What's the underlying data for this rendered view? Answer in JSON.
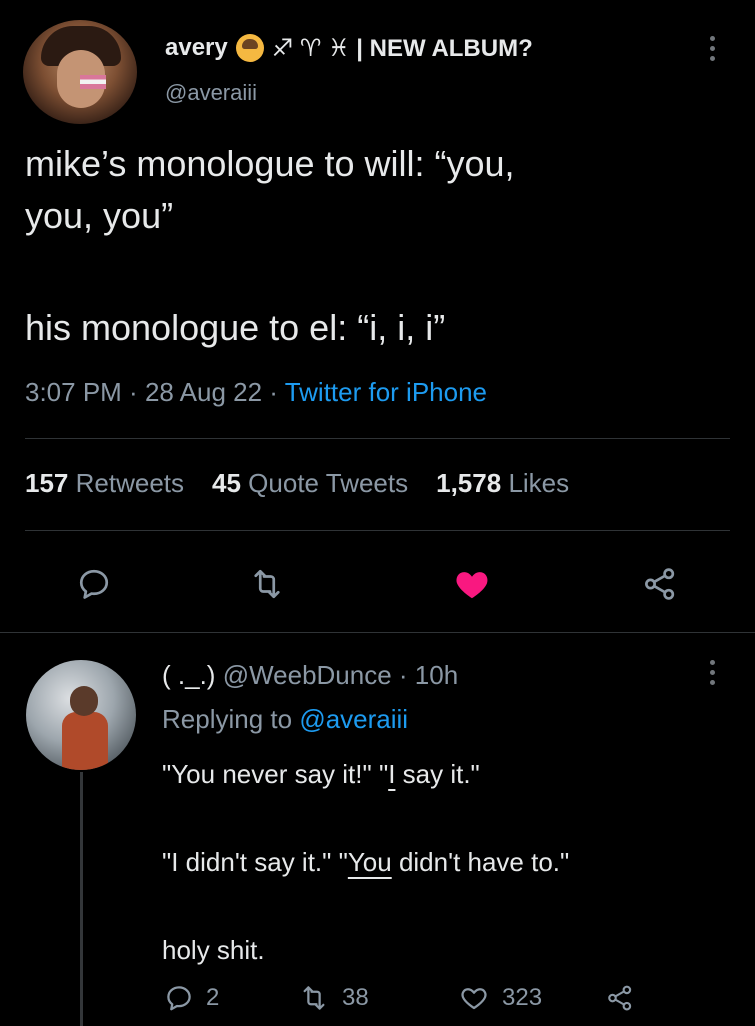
{
  "tweet": {
    "display_name": "avery",
    "name_emoji": "person-with-bun-emoji",
    "name_suffix": "♐ ♈ ♓ | NEW ALBUM?",
    "handle": "@averaiii",
    "text_lines": [
      "mike’s monologue to will: “you,",
      "you, you”"
    ],
    "text_lines_2": [
      "his monologue to el: “i, i, i”"
    ],
    "time": "3:07 PM",
    "date": "28 Aug 22",
    "source": "Twitter for iPhone",
    "meta_sep": " · ",
    "stats": [
      {
        "num": "157",
        "label": "Retweets"
      },
      {
        "num": "45",
        "label": "Quote Tweets"
      },
      {
        "num": "1,578",
        "label": "Likes"
      }
    ],
    "liked": true,
    "colors": {
      "like": "#f91880",
      "link": "#1d9bf0",
      "muted": "#8b98a5"
    }
  },
  "reply": {
    "display_name": "( ._.)",
    "handle": "@WeebDunce",
    "time_sep": " · ",
    "time": "10h",
    "replying_label": "Replying to ",
    "replying_handle": "@averaiii",
    "line1_a": "\"You never say it!\" \"",
    "line1_u": "I",
    "line1_b": " say it.\"",
    "line2_a": "\"I didn't say it.\" \"",
    "line2_u": "You",
    "line2_b": " didn't have to.\"",
    "line3": "holy shit.",
    "reply_count": "2",
    "retweet_count": "38",
    "like_count": "323"
  }
}
